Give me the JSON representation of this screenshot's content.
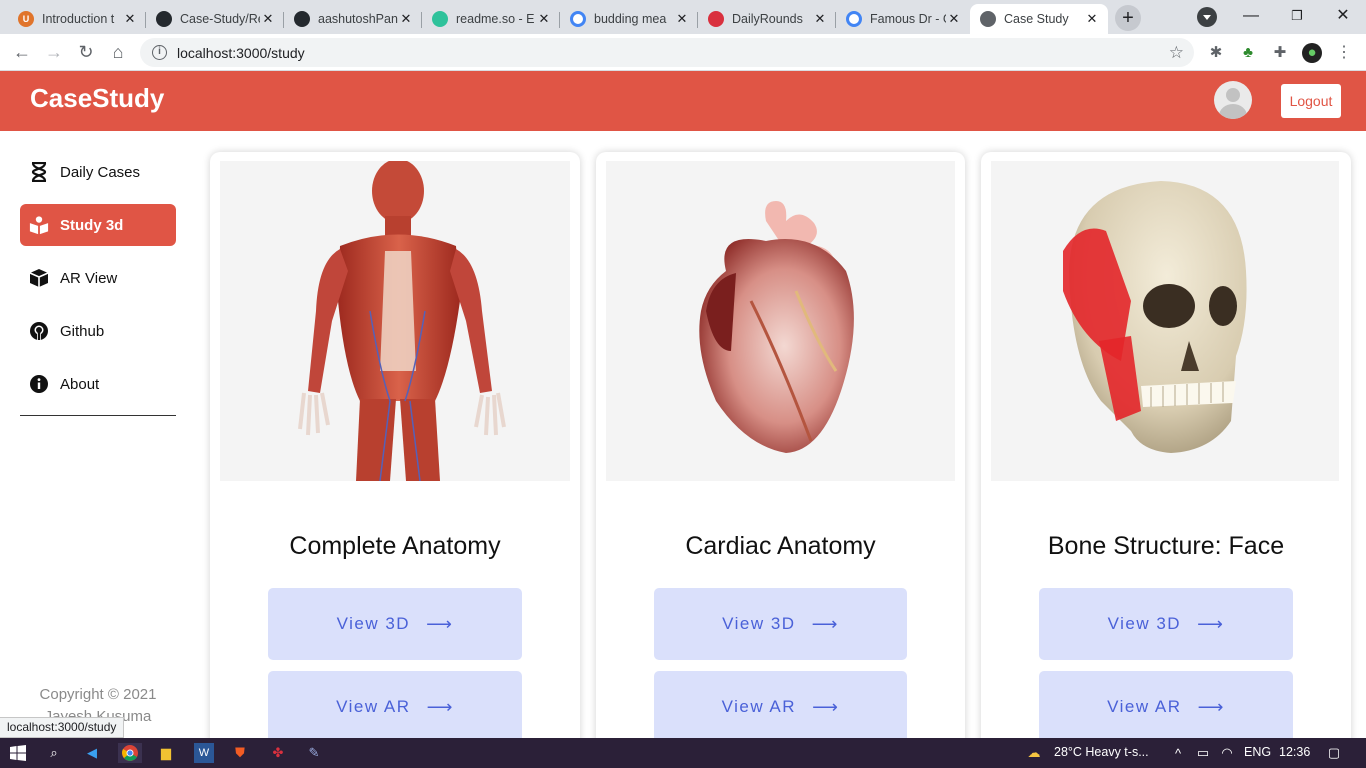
{
  "browser": {
    "tabs": [
      {
        "title": "Introduction t",
        "favicon_color": "#e0742b"
      },
      {
        "title": "Case-Study/Re",
        "favicon_color": "#24292e"
      },
      {
        "title": "aashutoshPan",
        "favicon_color": "#24292e"
      },
      {
        "title": "readme.so - E",
        "favicon_color": "#2fc29b"
      },
      {
        "title": "budding mea",
        "favicon_color": "#4285f4"
      },
      {
        "title": "DailyRounds",
        "favicon_color": "#d9303e"
      },
      {
        "title": "Famous Dr - G",
        "favicon_color": "#4285f4"
      },
      {
        "title": "Case Study",
        "favicon_color": "#5f6368"
      }
    ],
    "url": "localhost:3000/study",
    "status_url": "localhost:3000/study"
  },
  "app": {
    "brand": "CaseStudy",
    "logout_label": "Logout",
    "accent_color": "#e05545"
  },
  "sidebar": {
    "items": [
      {
        "label": "Daily Cases",
        "icon": "hourglass-icon"
      },
      {
        "label": "Study 3d",
        "icon": "book-reader-icon",
        "active": true
      },
      {
        "label": "AR View",
        "icon": "cube-icon"
      },
      {
        "label": "Github",
        "icon": "github-icon"
      },
      {
        "label": "About",
        "icon": "info-icon"
      }
    ],
    "copyright_line1": "Copyright © 2021",
    "copyright_line2": "Jayesh Kusuma"
  },
  "cards": [
    {
      "title": "Complete Anatomy",
      "image": "full-body-muscle-anatomy-image",
      "view3d_label": "View 3D",
      "viewar_label": "View AR"
    },
    {
      "title": "Cardiac Anatomy",
      "image": "heart-anatomy-image",
      "view3d_label": "View 3D",
      "viewar_label": "View AR"
    },
    {
      "title": "Bone Structure: Face",
      "image": "skull-anatomy-image",
      "view3d_label": "View 3D",
      "viewar_label": "View AR"
    }
  ],
  "taskbar": {
    "weather": "28°C  Heavy t-s...",
    "language": "ENG",
    "time": "12:36"
  }
}
